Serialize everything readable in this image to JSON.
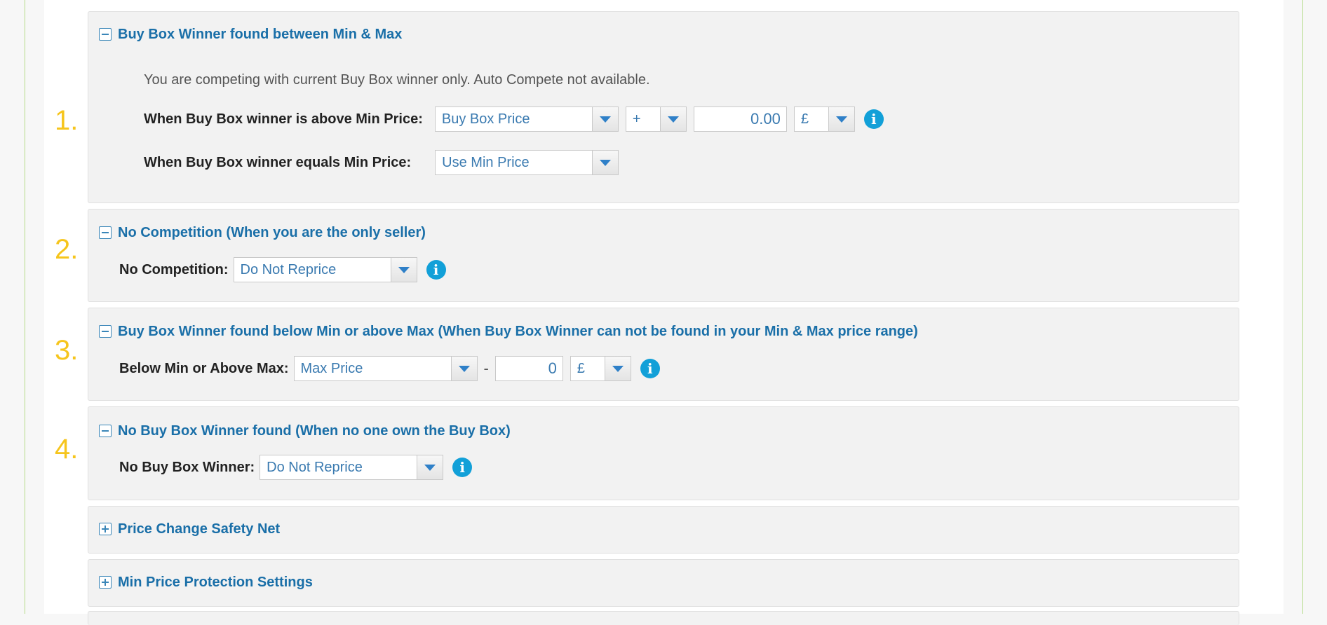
{
  "steps": [
    "1.",
    "2.",
    "3.",
    "4."
  ],
  "sections": {
    "s1": {
      "title": "Buy Box Winner found between Min & Max",
      "note": "You are competing with current Buy Box winner only. Auto Compete not available.",
      "above_label": "When Buy Box winner is above Min Price:",
      "above_select": "Buy Box Price",
      "operator": "+",
      "amount": "0.00",
      "currency": "£",
      "equals_label": "When Buy Box winner equals Min Price:",
      "equals_select": "Use Min Price"
    },
    "s2": {
      "title": "No Competition (When you are the only seller)",
      "label": "No Competition:",
      "select": "Do Not Reprice"
    },
    "s3": {
      "title": "Buy Box Winner found below Min or above Max (When Buy Box Winner can not be found in your Min & Max price range)",
      "label": "Below Min or Above Max:",
      "select": "Max Price",
      "dash": "-",
      "amount": "0",
      "currency": "£"
    },
    "s4": {
      "title": "No Buy Box Winner found (When no one own the Buy Box)",
      "label": "No Buy Box Winner:",
      "select": "Do Not Reprice"
    },
    "s5": {
      "title": "Price Change Safety Net"
    },
    "s6": {
      "title": "Min Price Protection Settings"
    }
  },
  "icons": {
    "info": "info-icon",
    "collapse": "minus-square-icon",
    "expand": "plus-square-icon"
  },
  "colors": {
    "link": "#1a6fa8",
    "step_number": "#f6c51c",
    "info": "#12a0d8"
  }
}
